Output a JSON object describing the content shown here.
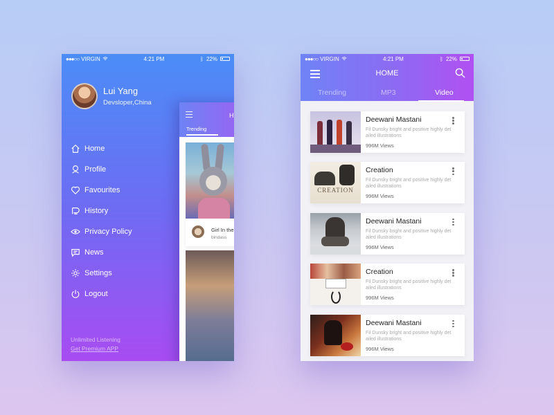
{
  "status_bar": {
    "carrier": "VIRGIN",
    "time": "4:21 PM",
    "battery": "22%"
  },
  "drawer": {
    "user_name": "Lui Yang",
    "user_subtitle": "Devsloper,China",
    "menu": [
      {
        "label": "Home",
        "icon": "home-icon"
      },
      {
        "label": "Profile",
        "icon": "profile-icon"
      },
      {
        "label": "Favourites",
        "icon": "heart-icon"
      },
      {
        "label": "History",
        "icon": "history-icon"
      },
      {
        "label": "Privacy Policy",
        "icon": "eye-icon"
      },
      {
        "label": "News",
        "icon": "chat-icon"
      },
      {
        "label": "Settings",
        "icon": "gear-icon"
      },
      {
        "label": "Logout",
        "icon": "power-icon"
      }
    ],
    "promo_text": "Unlimited Listening",
    "promo_link": "Get Premium APP"
  },
  "peek": {
    "title": "H",
    "tab": "Trending",
    "card_title": "Girl In the",
    "card_sub": "bindass"
  },
  "main": {
    "title": "HOME",
    "tabs": [
      "Trending",
      "MP3",
      "Video"
    ],
    "active_tab": "Video",
    "videos": [
      {
        "title": "Deewani Mastani",
        "desc": "Fil Dunsky bright and positive highly det ailed illustrations",
        "views": "996M Views",
        "thumb": "silhouettes"
      },
      {
        "title": "Creation",
        "desc": "Fil Dunsky bright and positive highly det ailed illustrations",
        "views": "996M Views",
        "thumb": "creation",
        "thumb_text": "CREATION"
      },
      {
        "title": "Deewani Mastani",
        "desc": "Fil Dunsky bright and positive highly det ailed illustrations",
        "views": "996M Views",
        "thumb": "water"
      },
      {
        "title": "Creation",
        "desc": "Fil Dunsky bright and positive highly det ailed illustrations",
        "views": "996M Views",
        "thumb": "poster"
      },
      {
        "title": "Deewani Mastani",
        "desc": "Fil Dunsky bright and positive highly det ailed illustrations",
        "views": "996M Views",
        "thumb": "warrior"
      }
    ]
  },
  "colors": {
    "gradient_start": "#4b8df7",
    "gradient_end": "#a84cf2",
    "header_start": "#6f83f6",
    "header_end": "#b150f2"
  }
}
